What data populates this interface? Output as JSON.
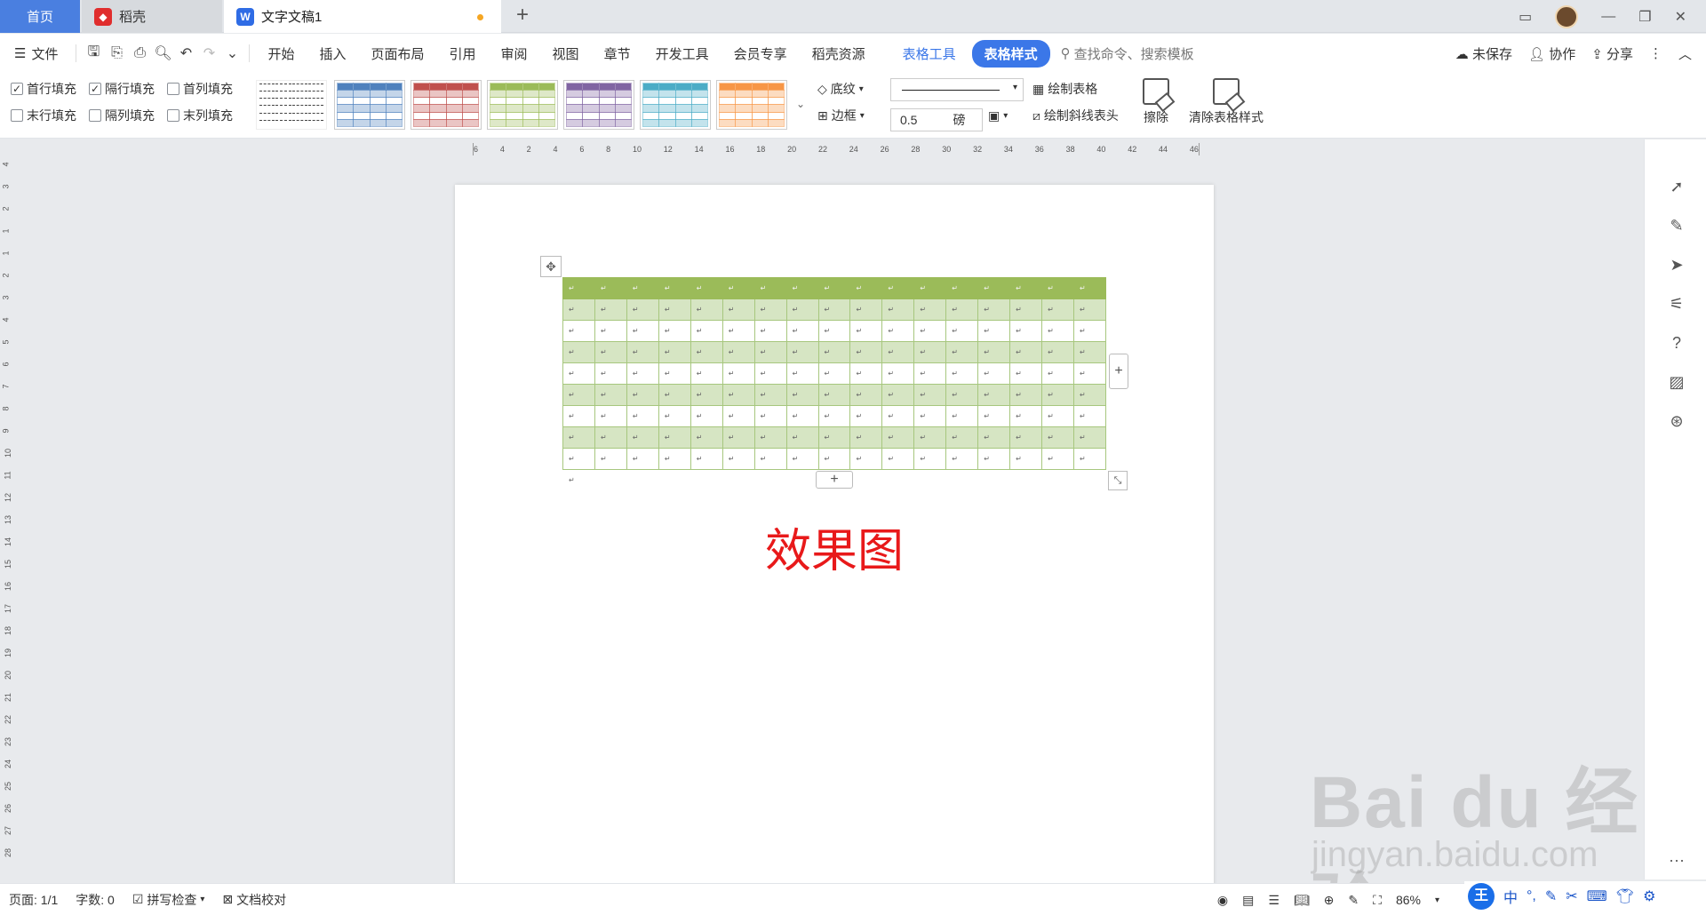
{
  "tabs": [
    {
      "label": "首页"
    },
    {
      "label": "稻壳"
    },
    {
      "label": "文字文稿1"
    }
  ],
  "menu": {
    "file": "文件",
    "items": [
      "开始",
      "插入",
      "页面布局",
      "引用",
      "审阅",
      "视图",
      "章节",
      "开发工具",
      "会员专享",
      "稻壳资源"
    ],
    "table_tools": "表格工具",
    "table_style": "表格样式",
    "search_placeholder": "查找命令、搜索模板",
    "unsaved": "未保存",
    "collab": "协作",
    "share": "分享"
  },
  "ribbon": {
    "checkboxes": [
      {
        "label": "首行填充",
        "checked": true
      },
      {
        "label": "隔行填充",
        "checked": true
      },
      {
        "label": "首列填充",
        "checked": false
      },
      {
        "label": "末行填充",
        "checked": false
      },
      {
        "label": "隔列填充",
        "checked": false
      },
      {
        "label": "末列填充",
        "checked": false
      }
    ],
    "swatch_colors": [
      "#4f81bd",
      "#c0504d",
      "#9bbb59",
      "#8064a2",
      "#4bacc6",
      "#f79646"
    ],
    "shading": "底纹",
    "border": "边框",
    "line_width": "0.5",
    "line_unit": "磅",
    "draw_table": "绘制表格",
    "draw_diagonal": "绘制斜线表头",
    "erase": "擦除",
    "clear_style": "清除表格样式"
  },
  "ruler": {
    "h_marks": [
      "6",
      "4",
      "2",
      "4",
      "6",
      "8",
      "10",
      "12",
      "14",
      "16",
      "18",
      "20",
      "22",
      "24",
      "26",
      "28",
      "30",
      "32",
      "34",
      "36",
      "38",
      "40",
      "42",
      "44",
      "46"
    ],
    "v_marks": [
      "4",
      "3",
      "2",
      "1",
      "1",
      "2",
      "3",
      "4",
      "5",
      "6",
      "7",
      "8",
      "9",
      "10",
      "11",
      "12",
      "13",
      "14",
      "15",
      "16",
      "17",
      "18",
      "19",
      "20",
      "21",
      "22",
      "23",
      "24",
      "25",
      "26",
      "27",
      "28"
    ]
  },
  "document": {
    "table": {
      "rows": 9,
      "cols": 17,
      "cell_mark": "↵",
      "header_color": "#9bbb59",
      "band_color": "#d6e5c3",
      "border_color": "#a7c77e"
    },
    "caption": "效果图",
    "caption_color": "#e8191a",
    "para_mark": "↵"
  },
  "status": {
    "page": "页面: 1/1",
    "words": "字数: 0",
    "spell": "拼写检查",
    "proof": "文档校对",
    "zoom": "86%"
  },
  "ime": {
    "logo": "王",
    "mode": "中"
  },
  "watermark": {
    "logo": "Bai du 经验",
    "url": "jingyan.baidu.com"
  }
}
